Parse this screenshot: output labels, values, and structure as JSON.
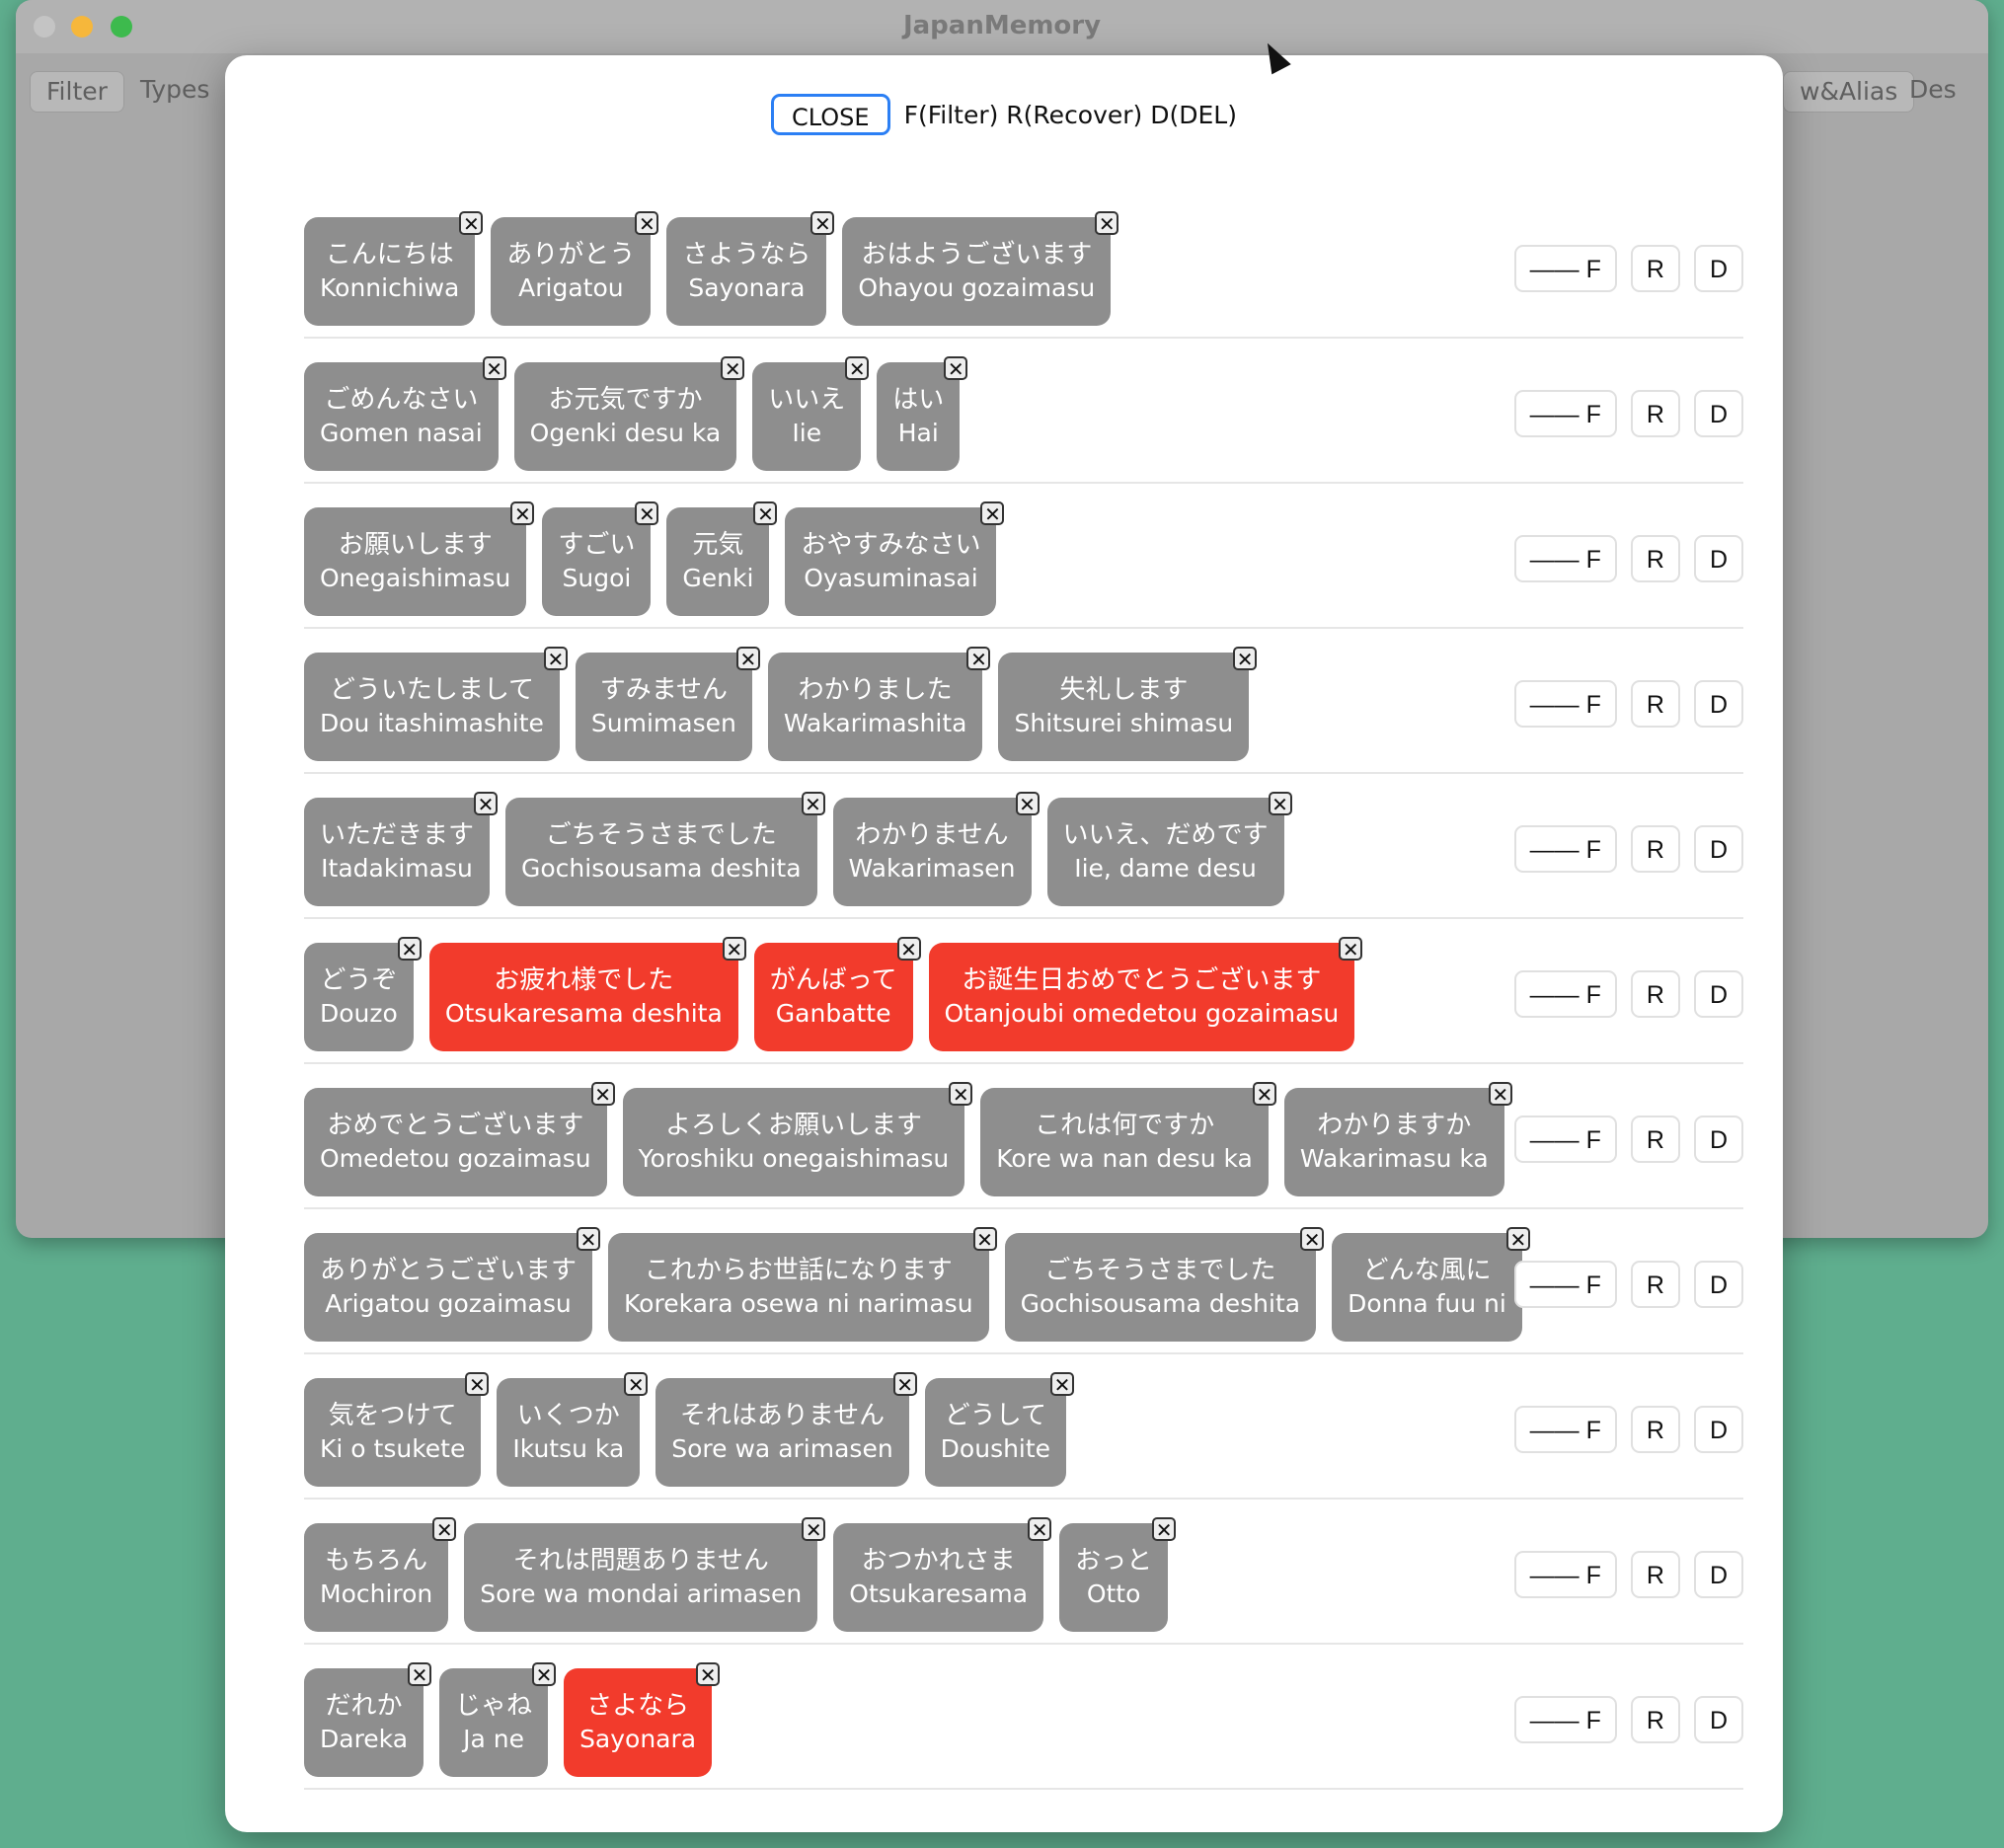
{
  "window": {
    "title": "JapanMemory",
    "toolbar_left": [
      "Filter",
      "Types"
    ],
    "toolbar_right_partial": "w&Alias",
    "toolbar_right_text": "Des"
  },
  "sheet": {
    "close_label": "CLOSE",
    "help_text": "F(Filter) R(Recover) D(DEL)"
  },
  "row_actions": {
    "filter": "—— F",
    "recover": "R",
    "delete": "D"
  },
  "chip_delete_glyph": "✕",
  "colors": {
    "chip_default": "#8e8e8e",
    "chip_highlight": "#f23b2c",
    "background": "#5fae8e",
    "close_border": "#2b7ff4"
  },
  "rows": [
    [
      {
        "jp": "こんにちは",
        "romaji": "Konnichiwa",
        "highlighted": false
      },
      {
        "jp": "ありがとう",
        "romaji": "Arigatou",
        "highlighted": false
      },
      {
        "jp": "さようなら",
        "romaji": "Sayonara",
        "highlighted": false
      },
      {
        "jp": "おはようございます",
        "romaji": "Ohayou gozaimasu",
        "highlighted": false
      }
    ],
    [
      {
        "jp": "ごめんなさい",
        "romaji": "Gomen nasai",
        "highlighted": false
      },
      {
        "jp": "お元気ですか",
        "romaji": "Ogenki desu ka",
        "highlighted": false
      },
      {
        "jp": "いいえ",
        "romaji": "Iie",
        "highlighted": false
      },
      {
        "jp": "はい",
        "romaji": "Hai",
        "highlighted": false
      }
    ],
    [
      {
        "jp": "お願いします",
        "romaji": "Onegaishimasu",
        "highlighted": false
      },
      {
        "jp": "すごい",
        "romaji": "Sugoi",
        "highlighted": false
      },
      {
        "jp": "元気",
        "romaji": "Genki",
        "highlighted": false
      },
      {
        "jp": "おやすみなさい",
        "romaji": "Oyasuminasai",
        "highlighted": false
      }
    ],
    [
      {
        "jp": "どういたしまして",
        "romaji": "Dou itashimashite",
        "highlighted": false
      },
      {
        "jp": "すみません",
        "romaji": "Sumimasen",
        "highlighted": false
      },
      {
        "jp": "わかりました",
        "romaji": "Wakarimashita",
        "highlighted": false
      },
      {
        "jp": "失礼します",
        "romaji": "Shitsurei shimasu",
        "highlighted": false
      }
    ],
    [
      {
        "jp": "いただきます",
        "romaji": "Itadakimasu",
        "highlighted": false
      },
      {
        "jp": "ごちそうさまでした",
        "romaji": "Gochisousama deshita",
        "highlighted": false
      },
      {
        "jp": "わかりません",
        "romaji": "Wakarimasen",
        "highlighted": false
      },
      {
        "jp": "いいえ、だめです",
        "romaji": "Iie, dame desu",
        "highlighted": false
      }
    ],
    [
      {
        "jp": "どうぞ",
        "romaji": "Douzo",
        "highlighted": false
      },
      {
        "jp": "お疲れ様でした",
        "romaji": "Otsukaresama deshita",
        "highlighted": true
      },
      {
        "jp": "がんばって",
        "romaji": "Ganbatte",
        "highlighted": true
      },
      {
        "jp": "お誕生日おめでとうございます",
        "romaji": "Otanjoubi omedetou gozaimasu",
        "highlighted": true
      }
    ],
    [
      {
        "jp": "おめでとうございます",
        "romaji": "Omedetou gozaimasu",
        "highlighted": false
      },
      {
        "jp": "よろしくお願いします",
        "romaji": "Yoroshiku onegaishimasu",
        "highlighted": false
      },
      {
        "jp": "これは何ですか",
        "romaji": "Kore wa nan desu ka",
        "highlighted": false
      },
      {
        "jp": "わかりますか",
        "romaji": "Wakarimasu ka",
        "highlighted": false
      }
    ],
    [
      {
        "jp": "ありがとうございます",
        "romaji": "Arigatou gozaimasu",
        "highlighted": false
      },
      {
        "jp": "これからお世話になります",
        "romaji": "Korekara osewa ni narimasu",
        "highlighted": false
      },
      {
        "jp": "ごちそうさまでした",
        "romaji": "Gochisousama deshita",
        "highlighted": false
      },
      {
        "jp": "どんな風に",
        "romaji": "Donna fuu ni",
        "highlighted": false
      }
    ],
    [
      {
        "jp": "気をつけて",
        "romaji": "Ki o tsukete",
        "highlighted": false
      },
      {
        "jp": "いくつか",
        "romaji": "Ikutsu ka",
        "highlighted": false
      },
      {
        "jp": "それはありません",
        "romaji": "Sore wa arimasen",
        "highlighted": false
      },
      {
        "jp": "どうして",
        "romaji": "Doushite",
        "highlighted": false
      }
    ],
    [
      {
        "jp": "もちろん",
        "romaji": "Mochiron",
        "highlighted": false
      },
      {
        "jp": "それは問題ありません",
        "romaji": "Sore wa mondai arimasen",
        "highlighted": false
      },
      {
        "jp": "おつかれさま",
        "romaji": "Otsukaresama",
        "highlighted": false
      },
      {
        "jp": "おっと",
        "romaji": "Otto",
        "highlighted": false
      }
    ],
    [
      {
        "jp": "だれか",
        "romaji": "Dareka",
        "highlighted": false
      },
      {
        "jp": "じゃね",
        "romaji": "Ja ne",
        "highlighted": false
      },
      {
        "jp": "さよなら",
        "romaji": "Sayonara",
        "highlighted": true
      }
    ]
  ]
}
